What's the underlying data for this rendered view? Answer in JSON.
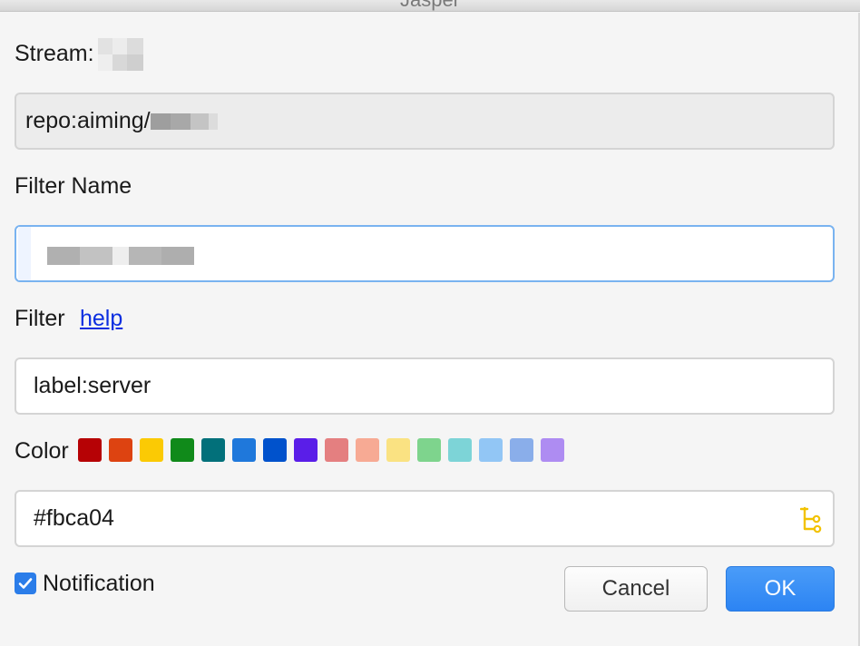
{
  "window": {
    "title": "Jasper"
  },
  "stream": {
    "label": "Stream:",
    "query_prefix": "repo:aiming/"
  },
  "filter_name": {
    "label": "Filter Name"
  },
  "filter": {
    "label": "Filter",
    "help_link": "help",
    "value": "label:server"
  },
  "color": {
    "label": "Color",
    "swatches": [
      "#b60205",
      "#d93f0b",
      "#fbca04",
      "#0e8a16",
      "#006b75",
      "#1d76db",
      "#0052cc",
      "#5319e7",
      "#e99695",
      "#f9d0c4",
      "#fef2c0",
      "#c2e0c6",
      "#bfdadc",
      "#c5def5",
      "#bfd4f2",
      "#d4c5f9"
    ],
    "swatch_display": [
      "#b60205",
      "#dd4311",
      "#fbca04",
      "#108a1a",
      "#02707a",
      "#1f78db",
      "#0052cc",
      "#5a1ee8",
      "#e47f80",
      "#f7aa94",
      "#fae282",
      "#7ed48d",
      "#7dd4d7",
      "#92c6f5",
      "#8aaeea",
      "#ae8cf2"
    ],
    "value": "#fbca04",
    "picker_icon": "color-picker-icon"
  },
  "notification": {
    "label": "Notification",
    "checked": true
  },
  "buttons": {
    "cancel": "Cancel",
    "ok": "OK"
  }
}
